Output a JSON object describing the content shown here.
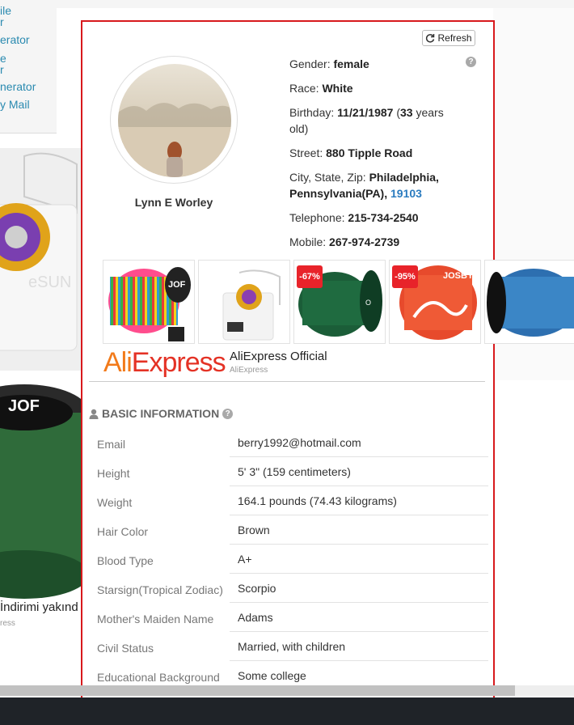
{
  "left_nav": {
    "links": [
      "ile",
      "r",
      "erator",
      "e",
      "r",
      "nerator",
      "y Mail"
    ]
  },
  "refresh": {
    "label": "Refresh"
  },
  "profile": {
    "name": "Lynn E Worley",
    "gender_label": "Gender:",
    "gender": "female",
    "race_label": "Race:",
    "race": "White",
    "birthday_label": "Birthday:",
    "birthday": "11/21/1987",
    "age_open": "(",
    "age": "33",
    "age_tail": "years old)",
    "street_label": "Street:",
    "street": "880 Tipple Road",
    "city_label": "City, State, Zip:",
    "city_state": "Philadelphia, Pennsylvania(PA),",
    "zip": "19103",
    "telephone_label": "Telephone:",
    "telephone": "215-734-2540",
    "mobile_label": "Mobile:",
    "mobile": "267-974-2739"
  },
  "ad": {
    "badges": [
      "-67%",
      "-95%"
    ],
    "logo_ali": "Ali",
    "logo_express": "Express",
    "store_name": "AliExpress Official",
    "store_sub": "AliExpress",
    "bg_text": "İndirimi yakınd",
    "bg_sub": "ress"
  },
  "basic_info": {
    "title": "BASIC INFORMATION",
    "rows": [
      {
        "label": "Email",
        "value": "berry1992@hotmail.com"
      },
      {
        "label": "Height",
        "value": "5' 3\" (159 centimeters)"
      },
      {
        "label": "Weight",
        "value": "164.1 pounds (74.43 kilograms)"
      },
      {
        "label": "Hair Color",
        "value": "Brown"
      },
      {
        "label": "Blood Type",
        "value": "A+"
      },
      {
        "label": "Starsign(Tropical Zodiac)",
        "value": "Scorpio"
      },
      {
        "label": "Mother's Maiden Name",
        "value": "Adams"
      },
      {
        "label": "Civil Status",
        "value": "Married, with children"
      },
      {
        "label": "Educational Background",
        "value": "Some college"
      }
    ]
  },
  "colors": {
    "panel_border": "#d8191d",
    "link": "#2a7bbf",
    "badge": "#e8232a"
  }
}
